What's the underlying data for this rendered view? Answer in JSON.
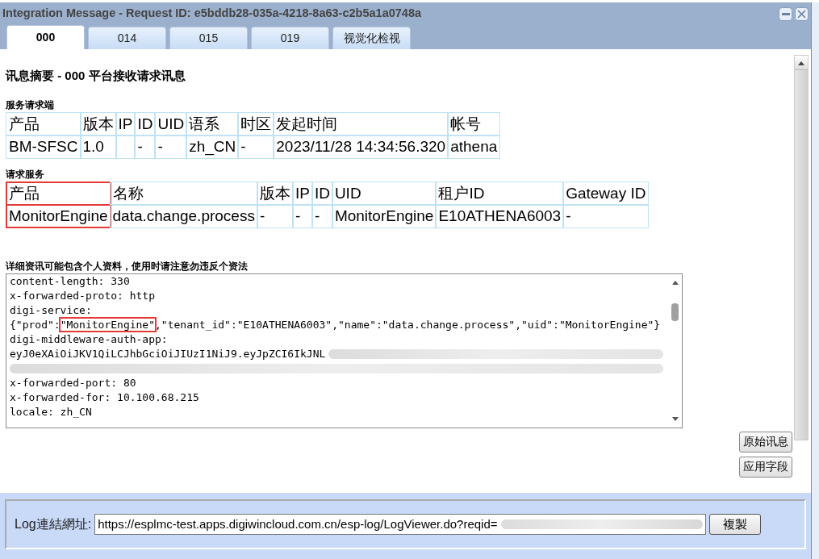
{
  "window": {
    "title": "Integration Message - Request ID: e5bddb28-035a-4218-8a63-c2b5a1a0748a"
  },
  "tabs": [
    {
      "label": "000",
      "selected": true
    },
    {
      "label": "014",
      "selected": false
    },
    {
      "label": "015",
      "selected": false
    },
    {
      "label": "019",
      "selected": false
    },
    {
      "label": "视觉化检视",
      "selected": false
    }
  ],
  "heading": "讯息摘要 - 000 平台接收请求讯息",
  "sections": [
    {
      "title": "服务请求端",
      "columns": [
        {
          "label": "产品",
          "highlighted": false
        },
        {
          "label": "版本",
          "highlighted": false
        },
        {
          "label": "IP",
          "highlighted": false
        },
        {
          "label": "ID",
          "highlighted": false
        },
        {
          "label": "UID",
          "highlighted": false
        },
        {
          "label": "语系",
          "highlighted": false
        },
        {
          "label": "时区",
          "highlighted": false
        },
        {
          "label": "发起时间",
          "highlighted": false
        },
        {
          "label": "帐号",
          "highlighted": false
        }
      ],
      "row": [
        {
          "kind": "text",
          "text": "BM-SFSC"
        },
        {
          "kind": "text",
          "text": "1.0"
        },
        {
          "kind": "blank"
        },
        {
          "kind": "text",
          "text": "-"
        },
        {
          "kind": "text",
          "text": "-"
        },
        {
          "kind": "text",
          "text": "zh_CN"
        },
        {
          "kind": "text",
          "text": "-"
        },
        {
          "kind": "text",
          "text": "2023/11/28 14:34:56.320"
        },
        {
          "kind": "text",
          "text": "athena"
        }
      ]
    },
    {
      "title": "请求服务",
      "columns": [
        {
          "label": "产品",
          "highlighted": true
        },
        {
          "label": "名称",
          "highlighted": false
        },
        {
          "label": "版本",
          "highlighted": false
        },
        {
          "label": "IP",
          "highlighted": false
        },
        {
          "label": "ID",
          "highlighted": false
        },
        {
          "label": "UID",
          "highlighted": false
        },
        {
          "label": "租户ID",
          "highlighted": false
        },
        {
          "label": "Gateway ID",
          "highlighted": false
        }
      ],
      "row": [
        {
          "kind": "text",
          "text": "MonitorEngine"
        },
        {
          "kind": "text",
          "text": "data.change.process"
        },
        {
          "kind": "text",
          "text": "-"
        },
        {
          "kind": "text",
          "text": "-"
        },
        {
          "kind": "text",
          "text": "-"
        },
        {
          "kind": "text",
          "text": "MonitorEngine"
        },
        {
          "kind": "text",
          "text": "E10ATHENA6003"
        },
        {
          "kind": "text",
          "text": "-"
        }
      ]
    }
  ],
  "details": {
    "notice": "详细资讯可能包含个人资料，使用时请注意勿违反个资法",
    "lines": [
      {
        "text": "content-length: 330",
        "kind": "plain"
      },
      {
        "text": "x-forwarded-proto: http",
        "kind": "plain"
      },
      {
        "text": "digi-service:",
        "kind": "plain"
      },
      {
        "text": "{\"prod\":",
        "highlight": "\"MonitorEngine\"",
        "rest": ",\"tenant_id\":\"E10ATHENA6003\",\"name\":\"data.change.process\",\"uid\":\"MonitorEngine\"}",
        "kind": "highlighted"
      },
      {
        "text": "digi-middleware-auth-app:",
        "kind": "plain"
      },
      {
        "text": "eyJ0eXAiOiJKV1QiLCJhbGciOiJIUzI1NiJ9.eyJpZCI6IkJNL",
        "kind": "redacted"
      },
      {
        "kind": "redacted"
      },
      {
        "text": "x-forwarded-port: 80",
        "kind": "plain"
      },
      {
        "text": "x-forwarded-for: 10.100.68.215",
        "kind": "plain"
      },
      {
        "text": "locale: zh_CN",
        "kind": "plain"
      }
    ]
  },
  "side_buttons": [
    "原始讯息",
    "应用字段"
  ],
  "log": {
    "label": "Log連結網址:",
    "value": "https://esplmc-test.apps.digiwincloud.com.cn/esp-log/LogViewer.do?reqid=",
    "copy_button": "複製"
  }
}
